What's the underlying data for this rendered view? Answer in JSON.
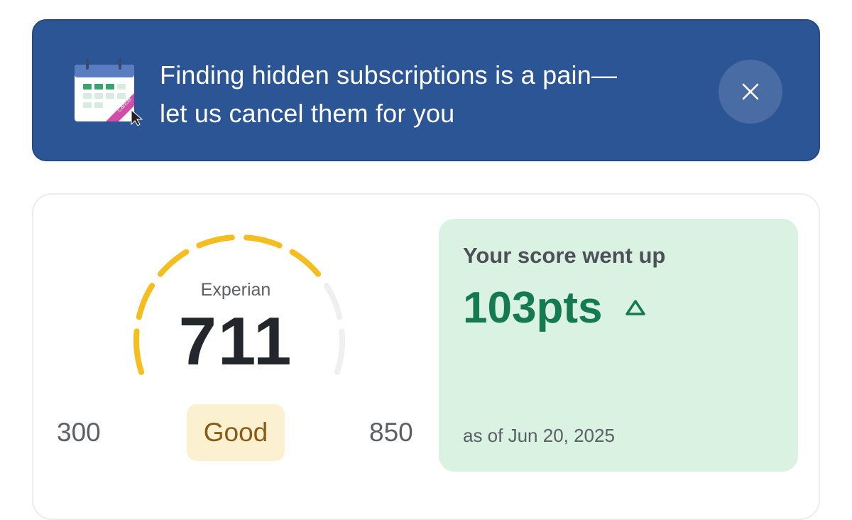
{
  "banner": {
    "line1": "Finding hidden subscriptions is a pain—",
    "line2": "let us cancel them for you",
    "illustration_tag": "Cancel",
    "illustration_icon": "calendar-cancel-icon",
    "close_icon": "close-icon"
  },
  "credit_score": {
    "bureau": "Experian",
    "score": "711",
    "range_min": "300",
    "range_max": "850",
    "rating": "Good",
    "gauge_fraction": 0.74,
    "colors": {
      "gauge_fill": "#f5bd1f",
      "gauge_track": "#efefef",
      "rating_bg": "#fbf0cf",
      "rating_text": "#8a5a14"
    }
  },
  "score_change": {
    "title": "Your score went up",
    "value": "103pts",
    "direction_icon": "triangle-up-icon",
    "as_of": "as of Jun 20, 2025",
    "colors": {
      "panel_bg": "#d9f2e1",
      "value": "#157a4d"
    }
  },
  "colors": {
    "banner_bg": "#2c5595",
    "close_bg": "#4a6ca4"
  }
}
